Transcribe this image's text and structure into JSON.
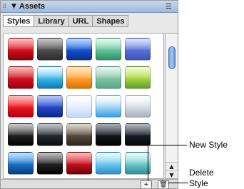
{
  "panel": {
    "title": "Assets",
    "grip_icon": "gripper-icon",
    "collapse_icon": "▼",
    "options_icon": "☰"
  },
  "tabs": [
    {
      "label": "Styles",
      "active": true
    },
    {
      "label": "Library",
      "active": false
    },
    {
      "label": "URL",
      "active": false
    },
    {
      "label": "Shapes",
      "active": false
    }
  ],
  "swatches": [
    {
      "name": "red-glossy-style",
      "colors": [
        "#ff7b7b",
        "#d21018",
        "#8c0008"
      ]
    },
    {
      "name": "charcoal-glossy-style",
      "colors": [
        "#888888",
        "#4b4b4b",
        "#2c2c2c"
      ]
    },
    {
      "name": "blue-square-glossy-style",
      "colors": [
        "#6db4ff",
        "#1450d2",
        "#0a2f8a"
      ]
    },
    {
      "name": "mint-bevel-style",
      "colors": [
        "#c8f2dc",
        "#61c398",
        "#2e8e66"
      ]
    },
    {
      "name": "periwinkle-style",
      "colors": [
        "#b8c8ff",
        "#5870d6",
        "#3c52b8"
      ]
    },
    {
      "name": "red-dot-style",
      "colors": [
        "#f36a6a",
        "#d0101e",
        "#9a0010"
      ]
    },
    {
      "name": "cyan-band-style",
      "colors": [
        "#e6f7ff",
        "#38b5e6",
        "#0a78b8"
      ]
    },
    {
      "name": "orange-gradient-style",
      "colors": [
        "#ffd58a",
        "#ff9c2a",
        "#e06f00"
      ]
    },
    {
      "name": "sea-green-style",
      "colors": [
        "#d2eed8",
        "#7dc2a4",
        "#54a887"
      ]
    },
    {
      "name": "lime-green-style",
      "colors": [
        "#e8f7a0",
        "#a6d43e",
        "#5c9e2a"
      ]
    },
    {
      "name": "bright-red-style",
      "colors": [
        "#ff7a7a",
        "#ec1620",
        "#b20010"
      ]
    },
    {
      "name": "navy-small-style",
      "colors": [
        "#6b8ef5",
        "#1f47c8",
        "#0c2886"
      ]
    },
    {
      "name": "pale-blue-style",
      "colors": [
        "#ffffff",
        "#e0ecff",
        "#c4d9f6"
      ]
    },
    {
      "name": "sky-blue-style",
      "colors": [
        "#ffffff",
        "#9ed5f5",
        "#3b9be3"
      ]
    },
    {
      "name": "silver-fade-style",
      "colors": [
        "#ffffff",
        "#d6dbe2",
        "#aab0ba"
      ]
    },
    {
      "name": "black-gel-style",
      "colors": [
        "#8a8a8a",
        "#1f1f1f",
        "#000000"
      ]
    },
    {
      "name": "dark-gel-style",
      "colors": [
        "#7a7f86",
        "#25292e",
        "#0b0c0e"
      ]
    },
    {
      "name": "bronze-gel-style",
      "colors": [
        "#b0a795",
        "#53483b",
        "#2c251c"
      ]
    },
    {
      "name": "midnight-gel-style",
      "colors": [
        "#444a58",
        "#15171d",
        "#000000"
      ]
    },
    {
      "name": "ink-gel-style",
      "colors": [
        "#595f70",
        "#1a1d27",
        "#05060a"
      ]
    },
    {
      "name": "blue-button-style",
      "colors": [
        "#7bc6ff",
        "#1a70c8",
        "#0a3a7a"
      ]
    },
    {
      "name": "black-button-style",
      "colors": [
        "#7a7a7a",
        "#202020",
        "#000000"
      ]
    },
    {
      "name": "crimson-button-style",
      "colors": [
        "#ff6b73",
        "#c3121e",
        "#6c0008"
      ]
    },
    {
      "name": "aqua-button-style",
      "colors": [
        "#d6f4ff",
        "#66c8f0",
        "#2a8cc8"
      ]
    },
    {
      "name": "teal-button-style",
      "colors": [
        "#d2f6f4",
        "#6ac6c8",
        "#2c8e96"
      ]
    }
  ],
  "scrollbar": {
    "up_arrow": "▲",
    "down_arrow": "▼"
  },
  "bottom_bar": {
    "new_style_icon": "+",
    "delete_style_icon": "🗑"
  },
  "callouts": {
    "new_style": "New Style",
    "delete_style_line1": "Delete",
    "delete_style_line2": "Style"
  }
}
